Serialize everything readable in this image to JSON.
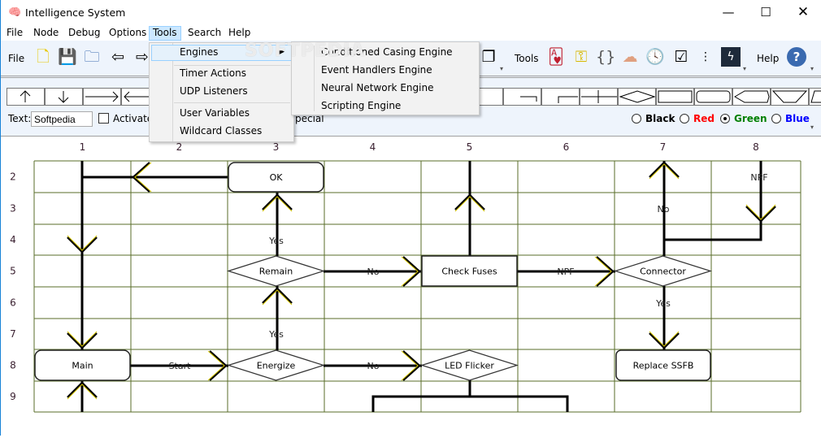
{
  "window": {
    "title": "Intelligence System",
    "app_icon": "brain-icon",
    "controls": [
      "minimize",
      "maximize",
      "close"
    ]
  },
  "menubar": [
    "File",
    "Node",
    "Debug",
    "Options",
    "Tools",
    "Search",
    "Help"
  ],
  "menubar_active": "Tools",
  "toolbar": {
    "file_label": "File",
    "tools_label": "Tools",
    "help_label": "Help",
    "file_icons": [
      "new-icon",
      "save-icon",
      "open-icon",
      "back-icon",
      "forward-icon"
    ],
    "tools_icons": [
      "cards-icon",
      "key-icon",
      "braces-icon",
      "brain-udp-icon",
      "clock-icon",
      "checkbox-icon",
      "network-icon",
      "lightning-icon"
    ],
    "help_icon": "help-icon",
    "text_label": "Text:",
    "text_value": "Softpedia",
    "activated_label": "Activated",
    "special_label": "pecial",
    "colors": [
      {
        "label": "Black",
        "color": "#000000",
        "selected": false
      },
      {
        "label": "Red",
        "color": "#ff0000",
        "selected": false
      },
      {
        "label": "Green",
        "color": "#008000",
        "selected": true
      },
      {
        "label": "Blue",
        "color": "#0000ff",
        "selected": false
      }
    ]
  },
  "tools_menu": {
    "items": [
      "Engines",
      "Timer Actions",
      "UDP Listeners",
      "User Variables",
      "Wildcard Classes"
    ],
    "highlighted": "Engines",
    "submenu": [
      "Conditioned Casing Engine",
      "Event Handlers Engine",
      "Neural Network Engine",
      "Scripting Engine"
    ]
  },
  "watermark": "SOFTPEDIA",
  "diagram": {
    "columns": [
      "1",
      "2",
      "3",
      "4",
      "5",
      "6",
      "7",
      "8"
    ],
    "rows": [
      "2",
      "3",
      "4",
      "5",
      "6",
      "7",
      "8",
      "9"
    ],
    "grid_color": "#5a6e2a",
    "nodes": [
      {
        "id": "ok",
        "label": "OK"
      },
      {
        "id": "remain",
        "label": "Remain"
      },
      {
        "id": "checkfuses",
        "label": "Check Fuses"
      },
      {
        "id": "connector",
        "label": "Connector"
      },
      {
        "id": "main",
        "label": "Main"
      },
      {
        "id": "energize",
        "label": "Energize"
      },
      {
        "id": "ledflicker",
        "label": "LED Flicker"
      },
      {
        "id": "replace",
        "label": "Replace SSFB"
      }
    ],
    "edge_labels": [
      "Yes",
      "No",
      "NPF",
      "No",
      "NPF",
      "Yes",
      "Start",
      "Yes",
      "No"
    ]
  }
}
